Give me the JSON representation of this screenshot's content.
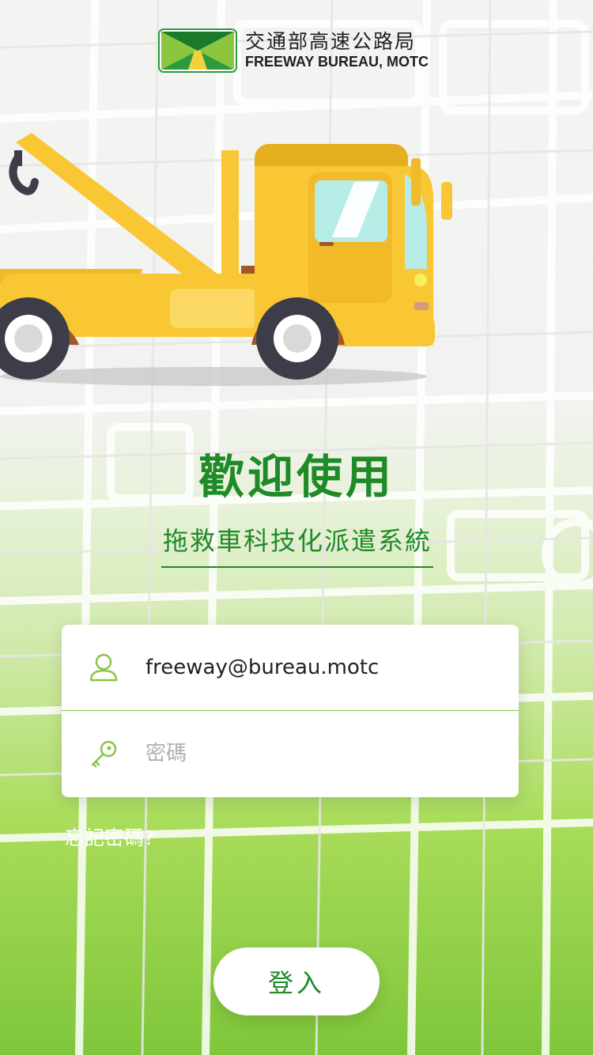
{
  "header": {
    "org_name_zh": "交通部高速公路局",
    "org_name_en": "FREEWAY BUREAU, MOTC"
  },
  "welcome": {
    "title": "歡迎使用",
    "subtitle": "拖救車科技化派遣系統"
  },
  "form": {
    "email_value": "freeway@bureau.motc",
    "password_placeholder": "密碼"
  },
  "links": {
    "forgot_password": "忘記密碼?"
  },
  "actions": {
    "login_label": "登入"
  },
  "colors": {
    "primary_green": "#1e8a28",
    "accent_green": "#8bc34a",
    "truck_yellow": "#f9c634",
    "logo_green": "#2e9a3e"
  },
  "icons": [
    "user-icon",
    "key-icon",
    "tow-truck-illustration",
    "freeway-bureau-logo"
  ]
}
